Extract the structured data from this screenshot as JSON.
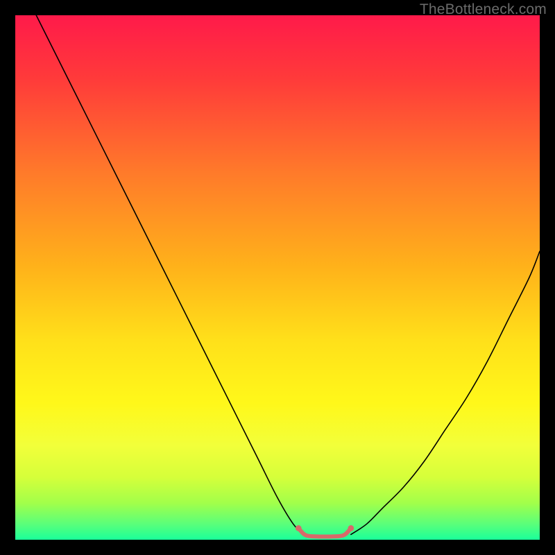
{
  "watermark": "TheBottleneck.com",
  "chart_data": {
    "type": "line",
    "title": "",
    "xlabel": "",
    "ylabel": "",
    "xlim": [
      0,
      100
    ],
    "ylim": [
      0,
      100
    ],
    "legend": false,
    "grid": false,
    "background_gradient": {
      "stops": [
        {
          "offset": 0.0,
          "color": "#ff1a4a"
        },
        {
          "offset": 0.12,
          "color": "#ff3a3a"
        },
        {
          "offset": 0.3,
          "color": "#ff7a2a"
        },
        {
          "offset": 0.48,
          "color": "#ffb21a"
        },
        {
          "offset": 0.62,
          "color": "#ffe01a"
        },
        {
          "offset": 0.74,
          "color": "#fff81a"
        },
        {
          "offset": 0.82,
          "color": "#f2ff3a"
        },
        {
          "offset": 0.88,
          "color": "#d6ff3a"
        },
        {
          "offset": 0.93,
          "color": "#a2ff4a"
        },
        {
          "offset": 0.97,
          "color": "#5aff7a"
        },
        {
          "offset": 1.0,
          "color": "#1aff9a"
        }
      ]
    },
    "series": [
      {
        "name": "curve-left",
        "stroke": "#000000",
        "stroke_width": 1.6,
        "x": [
          4,
          10,
          16,
          22,
          28,
          34,
          40,
          46,
          50,
          53,
          55
        ],
        "y": [
          100,
          88,
          76,
          64,
          52,
          40,
          28,
          16,
          8,
          3,
          1
        ]
      },
      {
        "name": "curve-right",
        "stroke": "#000000",
        "stroke_width": 1.6,
        "x": [
          64,
          67,
          70,
          74,
          78,
          82,
          86,
          90,
          94,
          98,
          100
        ],
        "y": [
          1,
          3,
          6,
          10,
          15,
          21,
          27,
          34,
          42,
          50,
          55
        ]
      },
      {
        "name": "valley-flat",
        "stroke": "#d86a6a",
        "stroke_width": 6,
        "x": [
          54,
          55,
          56,
          58,
          60,
          62,
          63,
          64
        ],
        "y": [
          2.2,
          1.1,
          0.7,
          0.6,
          0.6,
          0.7,
          1.1,
          2.2
        ]
      }
    ],
    "annotations": []
  }
}
